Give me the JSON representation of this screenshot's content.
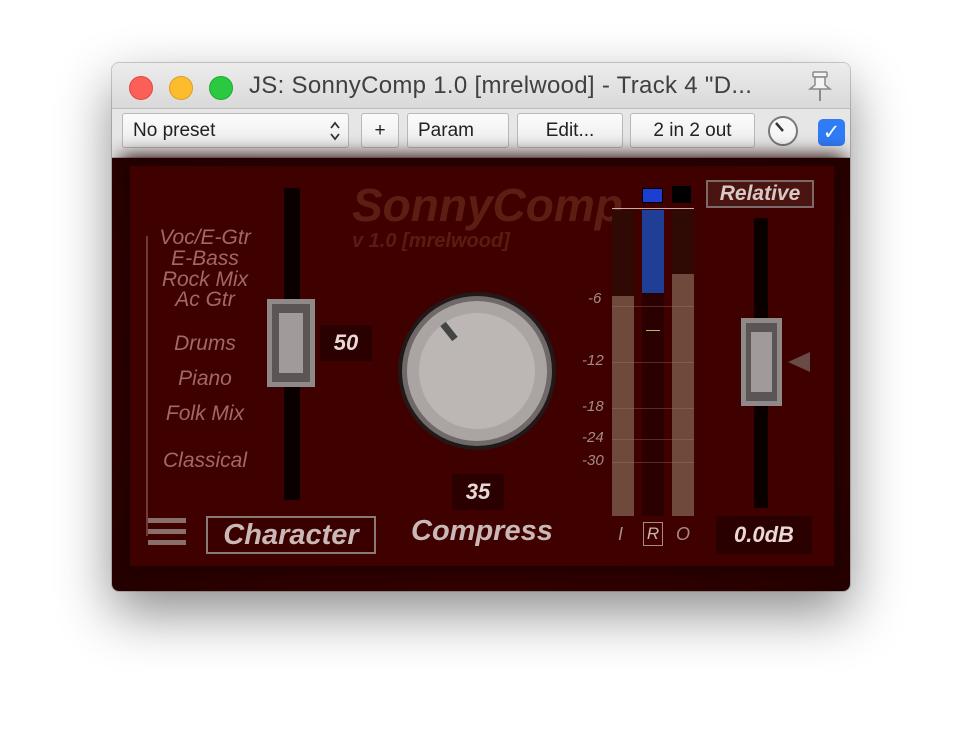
{
  "window": {
    "title": "JS: SonnyComp  1.0  [mrelwood] - Track 4 \"D..."
  },
  "toolbar": {
    "preset": "No preset",
    "add_label": "+",
    "param_label": "Param",
    "edit_label": "Edit...",
    "io_label": "2 in 2 out",
    "enabled": true
  },
  "plugin": {
    "name": "SonnyComp",
    "version": "v 1.0  [mrelwood]",
    "categories": [
      "Voc/E-Gtr",
      "E-Bass",
      "Rock Mix",
      "Ac Gtr",
      "Drums",
      "Piano",
      "Folk Mix",
      "Classical"
    ],
    "character_value": "50",
    "character_label": "Character",
    "compress_value": "35",
    "compress_label": "Compress",
    "relative_label": "Relative",
    "output_gain": "0.0dB",
    "meter_ticks": [
      "-6",
      "-12",
      "-18",
      "-24",
      "-30"
    ],
    "meter_labels": {
      "input": "I",
      "reduction": "R",
      "output": "O"
    },
    "meter_levels": {
      "input": 0.72,
      "reduction": 0.27,
      "output": 0.79
    },
    "colors": {
      "panel": "#3f0000",
      "reduction_meter": "#1f3f96",
      "knob": "#b7b2b0"
    }
  }
}
